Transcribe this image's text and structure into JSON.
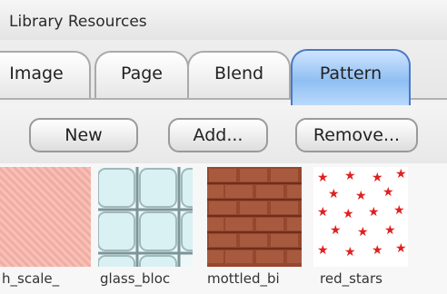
{
  "window": {
    "title": "Library Resources"
  },
  "tabs": [
    {
      "label": "Image",
      "selected": false
    },
    {
      "label": "Page",
      "selected": false
    },
    {
      "label": "Blend",
      "selected": false
    },
    {
      "label": "Pattern",
      "selected": true
    }
  ],
  "toolbar": {
    "new_label": "New",
    "add_label": "Add...",
    "remove_label": "Remove..."
  },
  "patterns": [
    {
      "label": "h_scale_",
      "icon": "pink-scale-pattern-thumbnail"
    },
    {
      "label": "glass_bloc",
      "icon": "glass-block-pattern-thumbnail"
    },
    {
      "label": "mottled_bi",
      "icon": "brick-pattern-thumbnail"
    },
    {
      "label": "red_stars",
      "icon": "red-stars-pattern-thumbnail"
    }
  ],
  "colors": {
    "selected_tab": "#8fbff3",
    "brick": "#9a4a34",
    "stars": "#e02020",
    "scale": "#f8b4aa"
  }
}
